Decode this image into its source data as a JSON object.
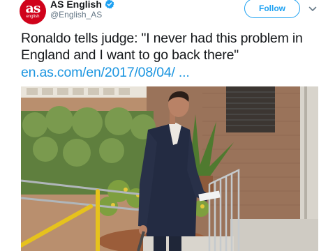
{
  "account": {
    "display_name": "AS English",
    "handle": "@English_AS",
    "avatar_logo": "as",
    "avatar_sub": "english"
  },
  "follow_button": {
    "label": "Follow"
  },
  "tweet": {
    "text": "Ronaldo tells judge: \"I never had this problem in England and I want to go back there\"",
    "link": "en.as.com/en/2017/08/04/ ..."
  },
  "colors": {
    "accent": "#1da1f2",
    "link": "#1b95e0",
    "avatar_bg": "#d0021b",
    "handle_gray": "#657786"
  },
  "icons": {
    "verified": "verified-badge-icon",
    "caret": "chevron-down-icon"
  }
}
